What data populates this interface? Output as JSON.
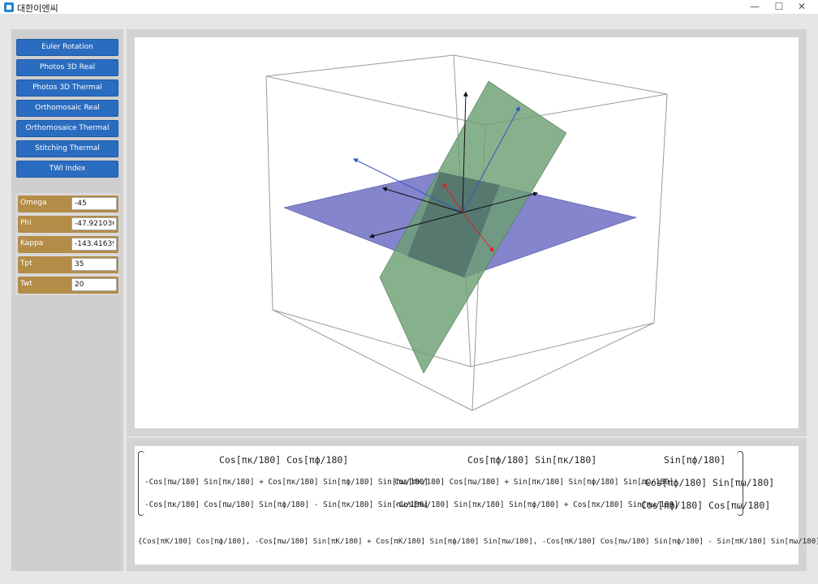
{
  "window": {
    "title": "대한이엔씨",
    "minimize_glyph": "—",
    "maximize_glyph": "☐",
    "close_glyph": "✕"
  },
  "menu": {
    "buttons": [
      "Euler Rotation",
      "Photos 3D Real",
      "Photos 3D Thermal",
      "Orthomosaic Real",
      "Orthomosaice Thermal",
      "Stitching Thermal",
      "TWI Index"
    ]
  },
  "params": [
    {
      "label": "Omega",
      "value": "-45"
    },
    {
      "label": "Phi",
      "value": "-47.921036"
    },
    {
      "label": "Kappa",
      "value": "-143.41639"
    },
    {
      "label": "Tpt",
      "value": "35"
    },
    {
      "label": "Twt",
      "value": "20"
    }
  ],
  "colors": {
    "button_blue": "#2a6cc0",
    "param_gold": "#b38c47",
    "plane_blue": "#6e70c4",
    "plane_green": "#6c9f74",
    "axis_red": "#e02020",
    "axis_blue": "#3355cc"
  },
  "formula": {
    "matrix_rows": [
      [
        "Cos[πκ/180] Cos[πϕ/180]",
        "Cos[πϕ/180] Sin[πκ/180]",
        "Sin[πϕ/180]"
      ],
      [
        "-Cos[πω/180] Sin[πκ/180] + Cos[πκ/180] Sin[πϕ/180] Sin[πω/180]",
        "Cos[πκ/180] Cos[πω/180] + Sin[πκ/180] Sin[πϕ/180] Sin[πω/180]",
        "-Cos[πϕ/180] Sin[πω/180]"
      ],
      [
        "-Cos[πκ/180] Cos[πω/180] Sin[πϕ/180] - Sin[πκ/180] Sin[πω/180]",
        "-Cos[πω/180] Sin[πκ/180] Sin[πϕ/180] + Cos[πκ/180] Sin[πω/180]",
        "Cos[πϕ/180] Cos[πω/180]"
      ]
    ],
    "vector": "{Cos[πK/180] Cos[πϕ/180], -Cos[πω/180] Sin[πK/180] + Cos[πK/180] Sin[πϕ/180] Sin[πω/180], -Cos[πK/180] Cos[πω/180] Sin[πϕ/180] - Sin[πK/180] Sin[πω/180]}"
  }
}
